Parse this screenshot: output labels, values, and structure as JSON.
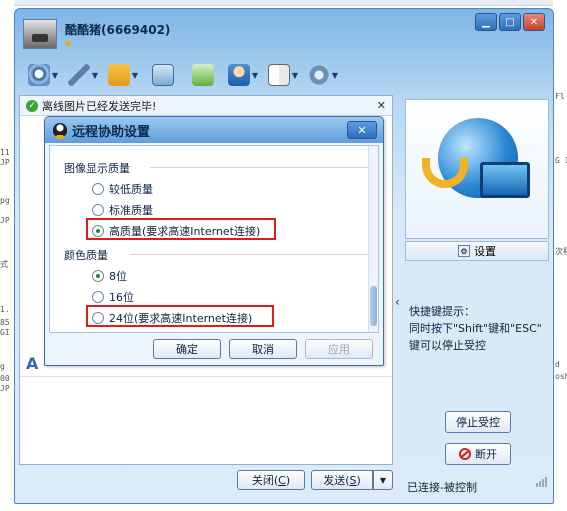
{
  "background": {
    "left_fragments": [
      "11",
      "JP",
      "pg",
      "JP",
      "式",
      "1.",
      "85",
      "GI",
      "g",
      "00",
      "JP"
    ],
    "right_fragments": [
      "Fl",
      "G I",
      "次程",
      "d",
      "osh"
    ]
  },
  "window": {
    "nickname": "酷酷猪(6669402)",
    "controls": [
      "▁",
      "□",
      "✕"
    ],
    "toolbar_icons": [
      "video-icon",
      "microphone-icon",
      "file-transfer-icon",
      "screen-capture-icon",
      "add-app-icon",
      "remote-user-icon",
      "game-cards-icon",
      "settings-icon"
    ]
  },
  "notice": {
    "text": "离线图片已经发送完毕!",
    "close": "✕"
  },
  "dialog": {
    "title": "远程协助设置",
    "close": "✕",
    "image_quality_heading": "图像显示质量",
    "image_quality_options": [
      {
        "label": "较低质量",
        "selected": false
      },
      {
        "label": "标准质量",
        "selected": false
      },
      {
        "label": "高质量(要求高速Internet连接)",
        "selected": true
      }
    ],
    "color_quality_heading": "颜色质量",
    "color_options": [
      {
        "label": "8位",
        "selected": true
      },
      {
        "label": "16位",
        "selected": false
      },
      {
        "label": "24位(要求高速Internet连接)",
        "selected": false
      }
    ],
    "ok": "确定",
    "cancel": "取消",
    "apply": "应用"
  },
  "chat": {
    "format_glyph": "A",
    "close_btn": "关闭(",
    "close_key": "C",
    "close_end": ")",
    "send_btn": "发送(",
    "send_key": "S",
    "send_end": ")",
    "send_dropdown": "▼"
  },
  "remote_panel": {
    "settings_label": "设置",
    "collapse": "‹",
    "hint_title": "快捷键提示：",
    "hint_line1": "同时按下\"Shift\"键和\"ESC\"",
    "hint_line2": "键可以停止受控",
    "stop_button": "停止受控",
    "disconnect_button": "断开",
    "status": "已连接-被控制"
  }
}
